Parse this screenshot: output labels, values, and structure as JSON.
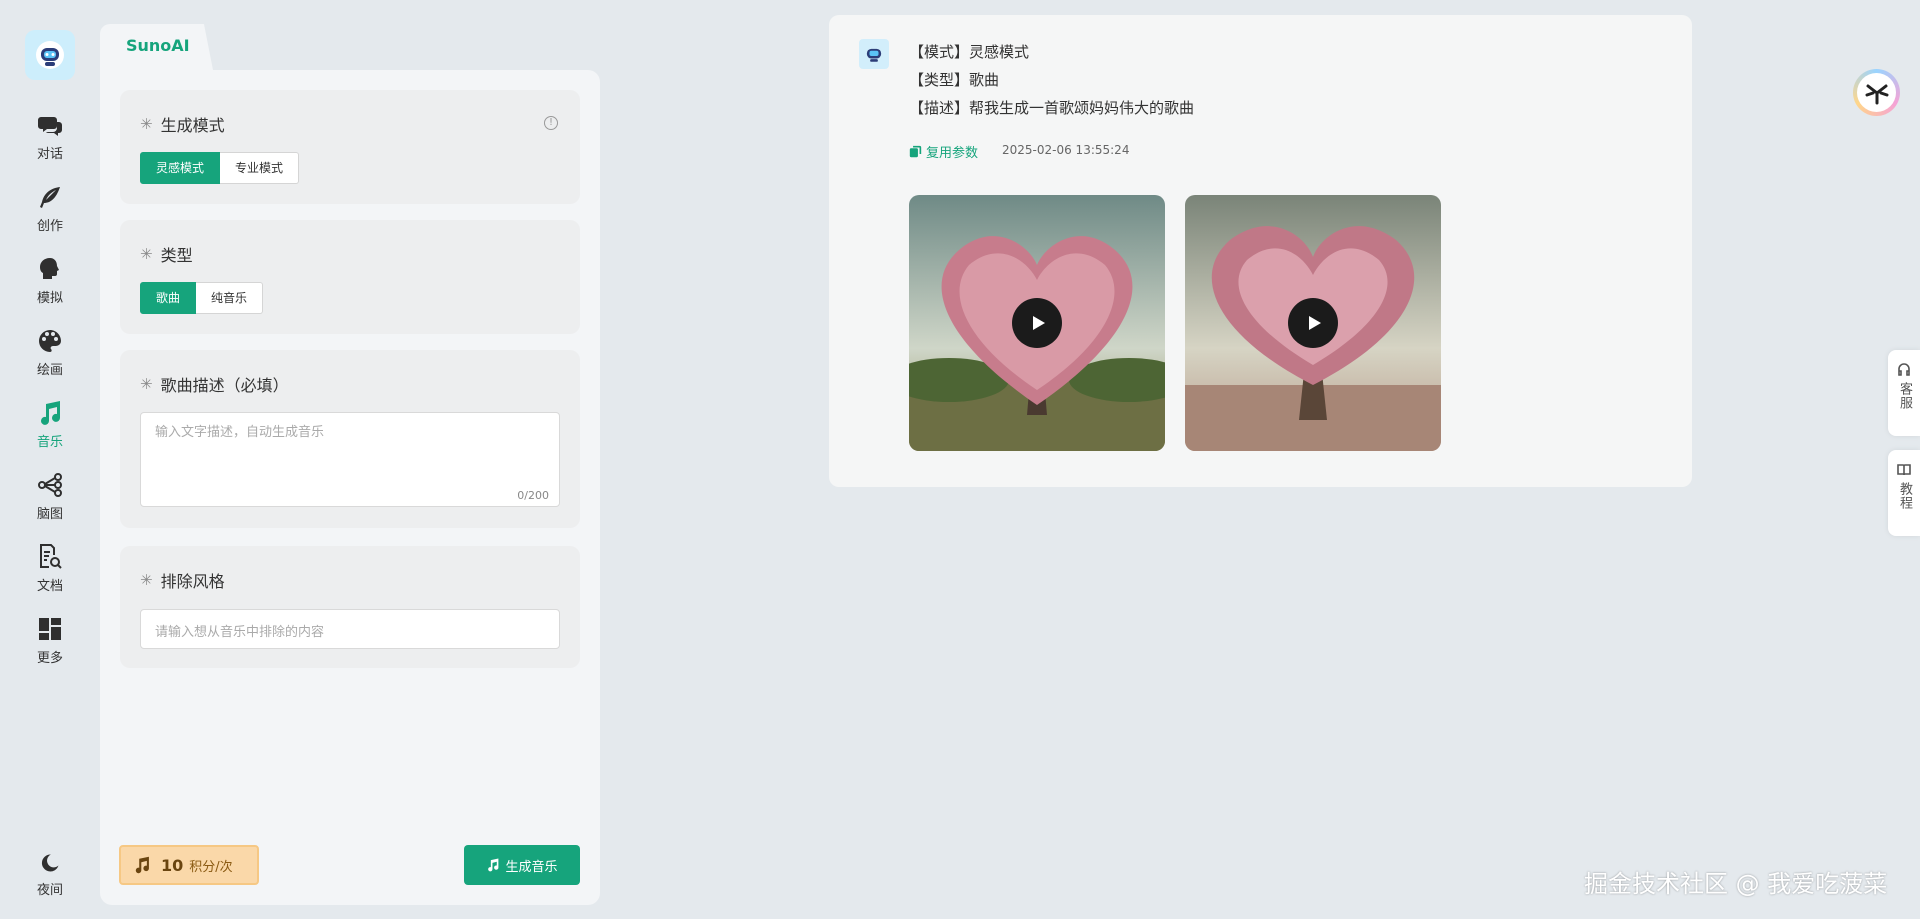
{
  "app": {
    "tab_label": "SunoAI"
  },
  "nav": {
    "items": [
      {
        "label": "对话",
        "icon": "chat-icon"
      },
      {
        "label": "创作",
        "icon": "feather-icon"
      },
      {
        "label": "模拟",
        "icon": "head-icon"
      },
      {
        "label": "绘画",
        "icon": "palette-icon"
      },
      {
        "label": "音乐",
        "icon": "music-icon",
        "active": true
      },
      {
        "label": "脑图",
        "icon": "mindmap-icon"
      },
      {
        "label": "文档",
        "icon": "document-search-icon"
      },
      {
        "label": "更多",
        "icon": "grid-icon"
      }
    ],
    "bottom": {
      "label": "夜间",
      "icon": "moon-icon"
    }
  },
  "form": {
    "mode": {
      "title": "生成模式",
      "options": [
        "灵感模式",
        "专业模式"
      ],
      "selected": "灵感模式"
    },
    "type": {
      "title": "类型",
      "options": [
        "歌曲",
        "纯音乐"
      ],
      "selected": "歌曲"
    },
    "description": {
      "title": "歌曲描述（必填）",
      "placeholder": "输入文字描述，自动生成音乐",
      "counter": "0/200"
    },
    "exclude": {
      "title": "排除风格",
      "placeholder": "请输入想从音乐中排除的内容"
    },
    "cost": {
      "value": "10",
      "unit": "积分/次"
    },
    "generate_label": "生成音乐"
  },
  "result": {
    "lines": [
      "【模式】灵感模式",
      "【类型】歌曲",
      "【描述】帮我生成一首歌颂妈妈伟大的歌曲"
    ],
    "reuse_label": "复用参数",
    "timestamp": "2025-02-06 13:55:24",
    "tracks": [
      {
        "art": "heart-tree-cover-1"
      },
      {
        "art": "heart-tree-cover-2"
      }
    ]
  },
  "side": {
    "service_label": "客服",
    "tutorial_label": "教程"
  },
  "watermark": "掘金技术社区 @ 我爱吃菠菜",
  "colors": {
    "accent": "#16a47c",
    "points_bg": "#fad8a9"
  }
}
